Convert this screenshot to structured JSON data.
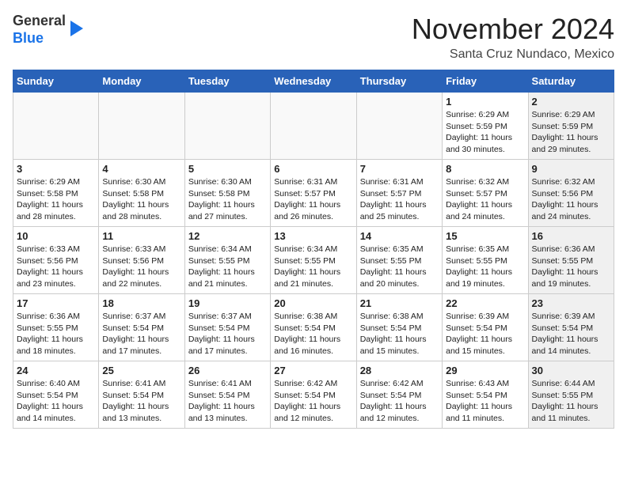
{
  "header": {
    "logo_general": "General",
    "logo_blue": "Blue",
    "month_title": "November 2024",
    "location": "Santa Cruz Nundaco, Mexico"
  },
  "weekdays": [
    "Sunday",
    "Monday",
    "Tuesday",
    "Wednesday",
    "Thursday",
    "Friday",
    "Saturday"
  ],
  "weeks": [
    [
      {
        "day": "",
        "info": "",
        "shaded": false,
        "empty": true
      },
      {
        "day": "",
        "info": "",
        "shaded": false,
        "empty": true
      },
      {
        "day": "",
        "info": "",
        "shaded": false,
        "empty": true
      },
      {
        "day": "",
        "info": "",
        "shaded": false,
        "empty": true
      },
      {
        "day": "",
        "info": "",
        "shaded": false,
        "empty": true
      },
      {
        "day": "1",
        "info": "Sunrise: 6:29 AM\nSunset: 5:59 PM\nDaylight: 11 hours and 30 minutes.",
        "shaded": false,
        "empty": false
      },
      {
        "day": "2",
        "info": "Sunrise: 6:29 AM\nSunset: 5:59 PM\nDaylight: 11 hours and 29 minutes.",
        "shaded": true,
        "empty": false
      }
    ],
    [
      {
        "day": "3",
        "info": "Sunrise: 6:29 AM\nSunset: 5:58 PM\nDaylight: 11 hours and 28 minutes.",
        "shaded": false,
        "empty": false
      },
      {
        "day": "4",
        "info": "Sunrise: 6:30 AM\nSunset: 5:58 PM\nDaylight: 11 hours and 28 minutes.",
        "shaded": false,
        "empty": false
      },
      {
        "day": "5",
        "info": "Sunrise: 6:30 AM\nSunset: 5:58 PM\nDaylight: 11 hours and 27 minutes.",
        "shaded": false,
        "empty": false
      },
      {
        "day": "6",
        "info": "Sunrise: 6:31 AM\nSunset: 5:57 PM\nDaylight: 11 hours and 26 minutes.",
        "shaded": false,
        "empty": false
      },
      {
        "day": "7",
        "info": "Sunrise: 6:31 AM\nSunset: 5:57 PM\nDaylight: 11 hours and 25 minutes.",
        "shaded": false,
        "empty": false
      },
      {
        "day": "8",
        "info": "Sunrise: 6:32 AM\nSunset: 5:57 PM\nDaylight: 11 hours and 24 minutes.",
        "shaded": false,
        "empty": false
      },
      {
        "day": "9",
        "info": "Sunrise: 6:32 AM\nSunset: 5:56 PM\nDaylight: 11 hours and 24 minutes.",
        "shaded": true,
        "empty": false
      }
    ],
    [
      {
        "day": "10",
        "info": "Sunrise: 6:33 AM\nSunset: 5:56 PM\nDaylight: 11 hours and 23 minutes.",
        "shaded": false,
        "empty": false
      },
      {
        "day": "11",
        "info": "Sunrise: 6:33 AM\nSunset: 5:56 PM\nDaylight: 11 hours and 22 minutes.",
        "shaded": false,
        "empty": false
      },
      {
        "day": "12",
        "info": "Sunrise: 6:34 AM\nSunset: 5:55 PM\nDaylight: 11 hours and 21 minutes.",
        "shaded": false,
        "empty": false
      },
      {
        "day": "13",
        "info": "Sunrise: 6:34 AM\nSunset: 5:55 PM\nDaylight: 11 hours and 21 minutes.",
        "shaded": false,
        "empty": false
      },
      {
        "day": "14",
        "info": "Sunrise: 6:35 AM\nSunset: 5:55 PM\nDaylight: 11 hours and 20 minutes.",
        "shaded": false,
        "empty": false
      },
      {
        "day": "15",
        "info": "Sunrise: 6:35 AM\nSunset: 5:55 PM\nDaylight: 11 hours and 19 minutes.",
        "shaded": false,
        "empty": false
      },
      {
        "day": "16",
        "info": "Sunrise: 6:36 AM\nSunset: 5:55 PM\nDaylight: 11 hours and 19 minutes.",
        "shaded": true,
        "empty": false
      }
    ],
    [
      {
        "day": "17",
        "info": "Sunrise: 6:36 AM\nSunset: 5:55 PM\nDaylight: 11 hours and 18 minutes.",
        "shaded": false,
        "empty": false
      },
      {
        "day": "18",
        "info": "Sunrise: 6:37 AM\nSunset: 5:54 PM\nDaylight: 11 hours and 17 minutes.",
        "shaded": false,
        "empty": false
      },
      {
        "day": "19",
        "info": "Sunrise: 6:37 AM\nSunset: 5:54 PM\nDaylight: 11 hours and 17 minutes.",
        "shaded": false,
        "empty": false
      },
      {
        "day": "20",
        "info": "Sunrise: 6:38 AM\nSunset: 5:54 PM\nDaylight: 11 hours and 16 minutes.",
        "shaded": false,
        "empty": false
      },
      {
        "day": "21",
        "info": "Sunrise: 6:38 AM\nSunset: 5:54 PM\nDaylight: 11 hours and 15 minutes.",
        "shaded": false,
        "empty": false
      },
      {
        "day": "22",
        "info": "Sunrise: 6:39 AM\nSunset: 5:54 PM\nDaylight: 11 hours and 15 minutes.",
        "shaded": false,
        "empty": false
      },
      {
        "day": "23",
        "info": "Sunrise: 6:39 AM\nSunset: 5:54 PM\nDaylight: 11 hours and 14 minutes.",
        "shaded": true,
        "empty": false
      }
    ],
    [
      {
        "day": "24",
        "info": "Sunrise: 6:40 AM\nSunset: 5:54 PM\nDaylight: 11 hours and 14 minutes.",
        "shaded": false,
        "empty": false
      },
      {
        "day": "25",
        "info": "Sunrise: 6:41 AM\nSunset: 5:54 PM\nDaylight: 11 hours and 13 minutes.",
        "shaded": false,
        "empty": false
      },
      {
        "day": "26",
        "info": "Sunrise: 6:41 AM\nSunset: 5:54 PM\nDaylight: 11 hours and 13 minutes.",
        "shaded": false,
        "empty": false
      },
      {
        "day": "27",
        "info": "Sunrise: 6:42 AM\nSunset: 5:54 PM\nDaylight: 11 hours and 12 minutes.",
        "shaded": false,
        "empty": false
      },
      {
        "day": "28",
        "info": "Sunrise: 6:42 AM\nSunset: 5:54 PM\nDaylight: 11 hours and 12 minutes.",
        "shaded": false,
        "empty": false
      },
      {
        "day": "29",
        "info": "Sunrise: 6:43 AM\nSunset: 5:54 PM\nDaylight: 11 hours and 11 minutes.",
        "shaded": false,
        "empty": false
      },
      {
        "day": "30",
        "info": "Sunrise: 6:44 AM\nSunset: 5:55 PM\nDaylight: 11 hours and 11 minutes.",
        "shaded": true,
        "empty": false
      }
    ]
  ]
}
